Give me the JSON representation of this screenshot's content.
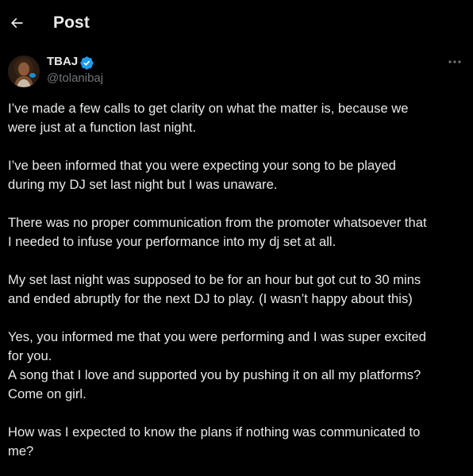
{
  "header": {
    "title": "Post",
    "back_icon": "arrow-left-icon"
  },
  "author": {
    "name": "TBAJ",
    "handle": "@tolanibaj",
    "verified": true,
    "verified_icon": "verified-badge-icon",
    "verified_color": "#1d9bf0"
  },
  "more_icon": "more-options-icon",
  "post": {
    "paragraphs": [
      "I’ve made a few calls to get clarity on what the matter is, because we\nwere just at a function last night.",
      "I’ve been informed that you were expecting your song to be played\nduring my DJ set last night but I was unaware.",
      "There was no proper communication from the promoter whatsoever that\nI needed to infuse your performance into my dj set at all.",
      "My set last night was supposed to be for an hour but got cut to 30 mins\nand ended abruptly for the next DJ to play. (I wasn’t happy about this)",
      "Yes, you informed me that you were performing and I was super excited\nfor you.\nA song that I love and supported you by pushing it on all my platforms?\nCome on girl.",
      "How was I expected to know the plans if nothing was communicated to\nme?"
    ]
  },
  "colors": {
    "background": "#000000",
    "text_primary": "#e7e9ea",
    "text_secondary": "#71767b",
    "accent": "#1d9bf0"
  }
}
